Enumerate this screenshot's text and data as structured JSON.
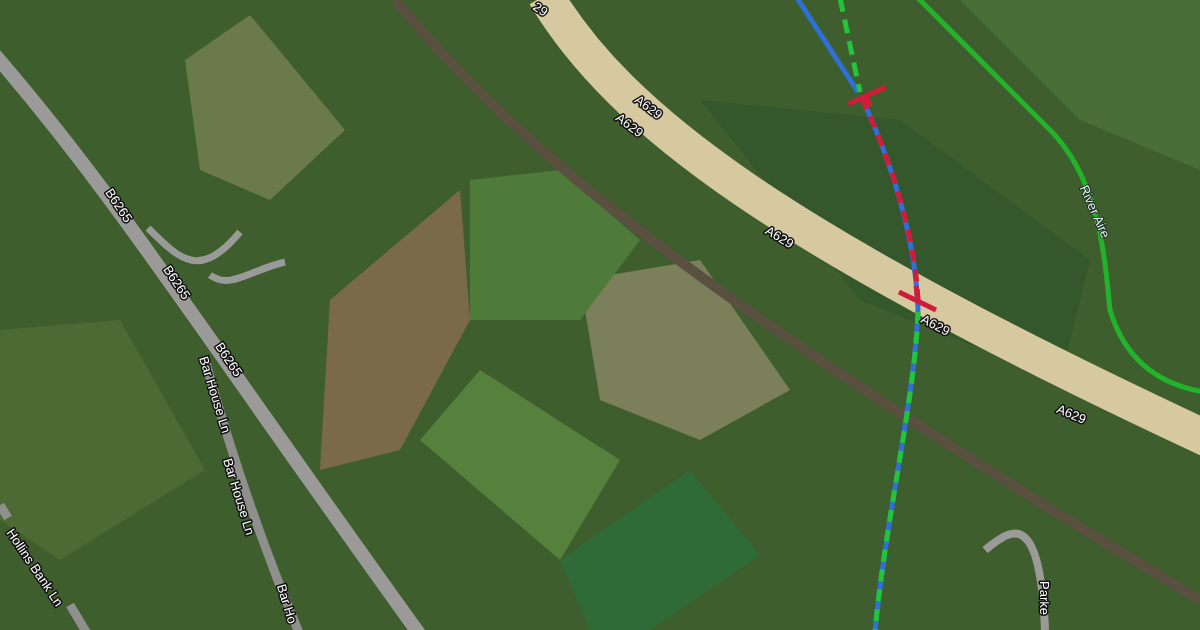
{
  "map": {
    "labels": [
      {
        "kind": "road",
        "text": "29"
      },
      {
        "kind": "road",
        "text": "A629"
      },
      {
        "kind": "road",
        "text": "A629"
      },
      {
        "kind": "road",
        "text": "A629"
      },
      {
        "kind": "road",
        "text": "A629"
      },
      {
        "kind": "road",
        "text": "A629"
      },
      {
        "kind": "water",
        "text": "River Aire"
      },
      {
        "kind": "road",
        "text": "B6265"
      },
      {
        "kind": "road",
        "text": "B6265"
      },
      {
        "kind": "road",
        "text": "B6265"
      },
      {
        "kind": "road",
        "text": "Bar House Ln"
      },
      {
        "kind": "road",
        "text": "Bar House Ln"
      },
      {
        "kind": "road",
        "text": "Bar Ho"
      },
      {
        "kind": "road",
        "text": "Hollins Bank Ln"
      },
      {
        "kind": "road",
        "text": "Parke"
      }
    ]
  }
}
